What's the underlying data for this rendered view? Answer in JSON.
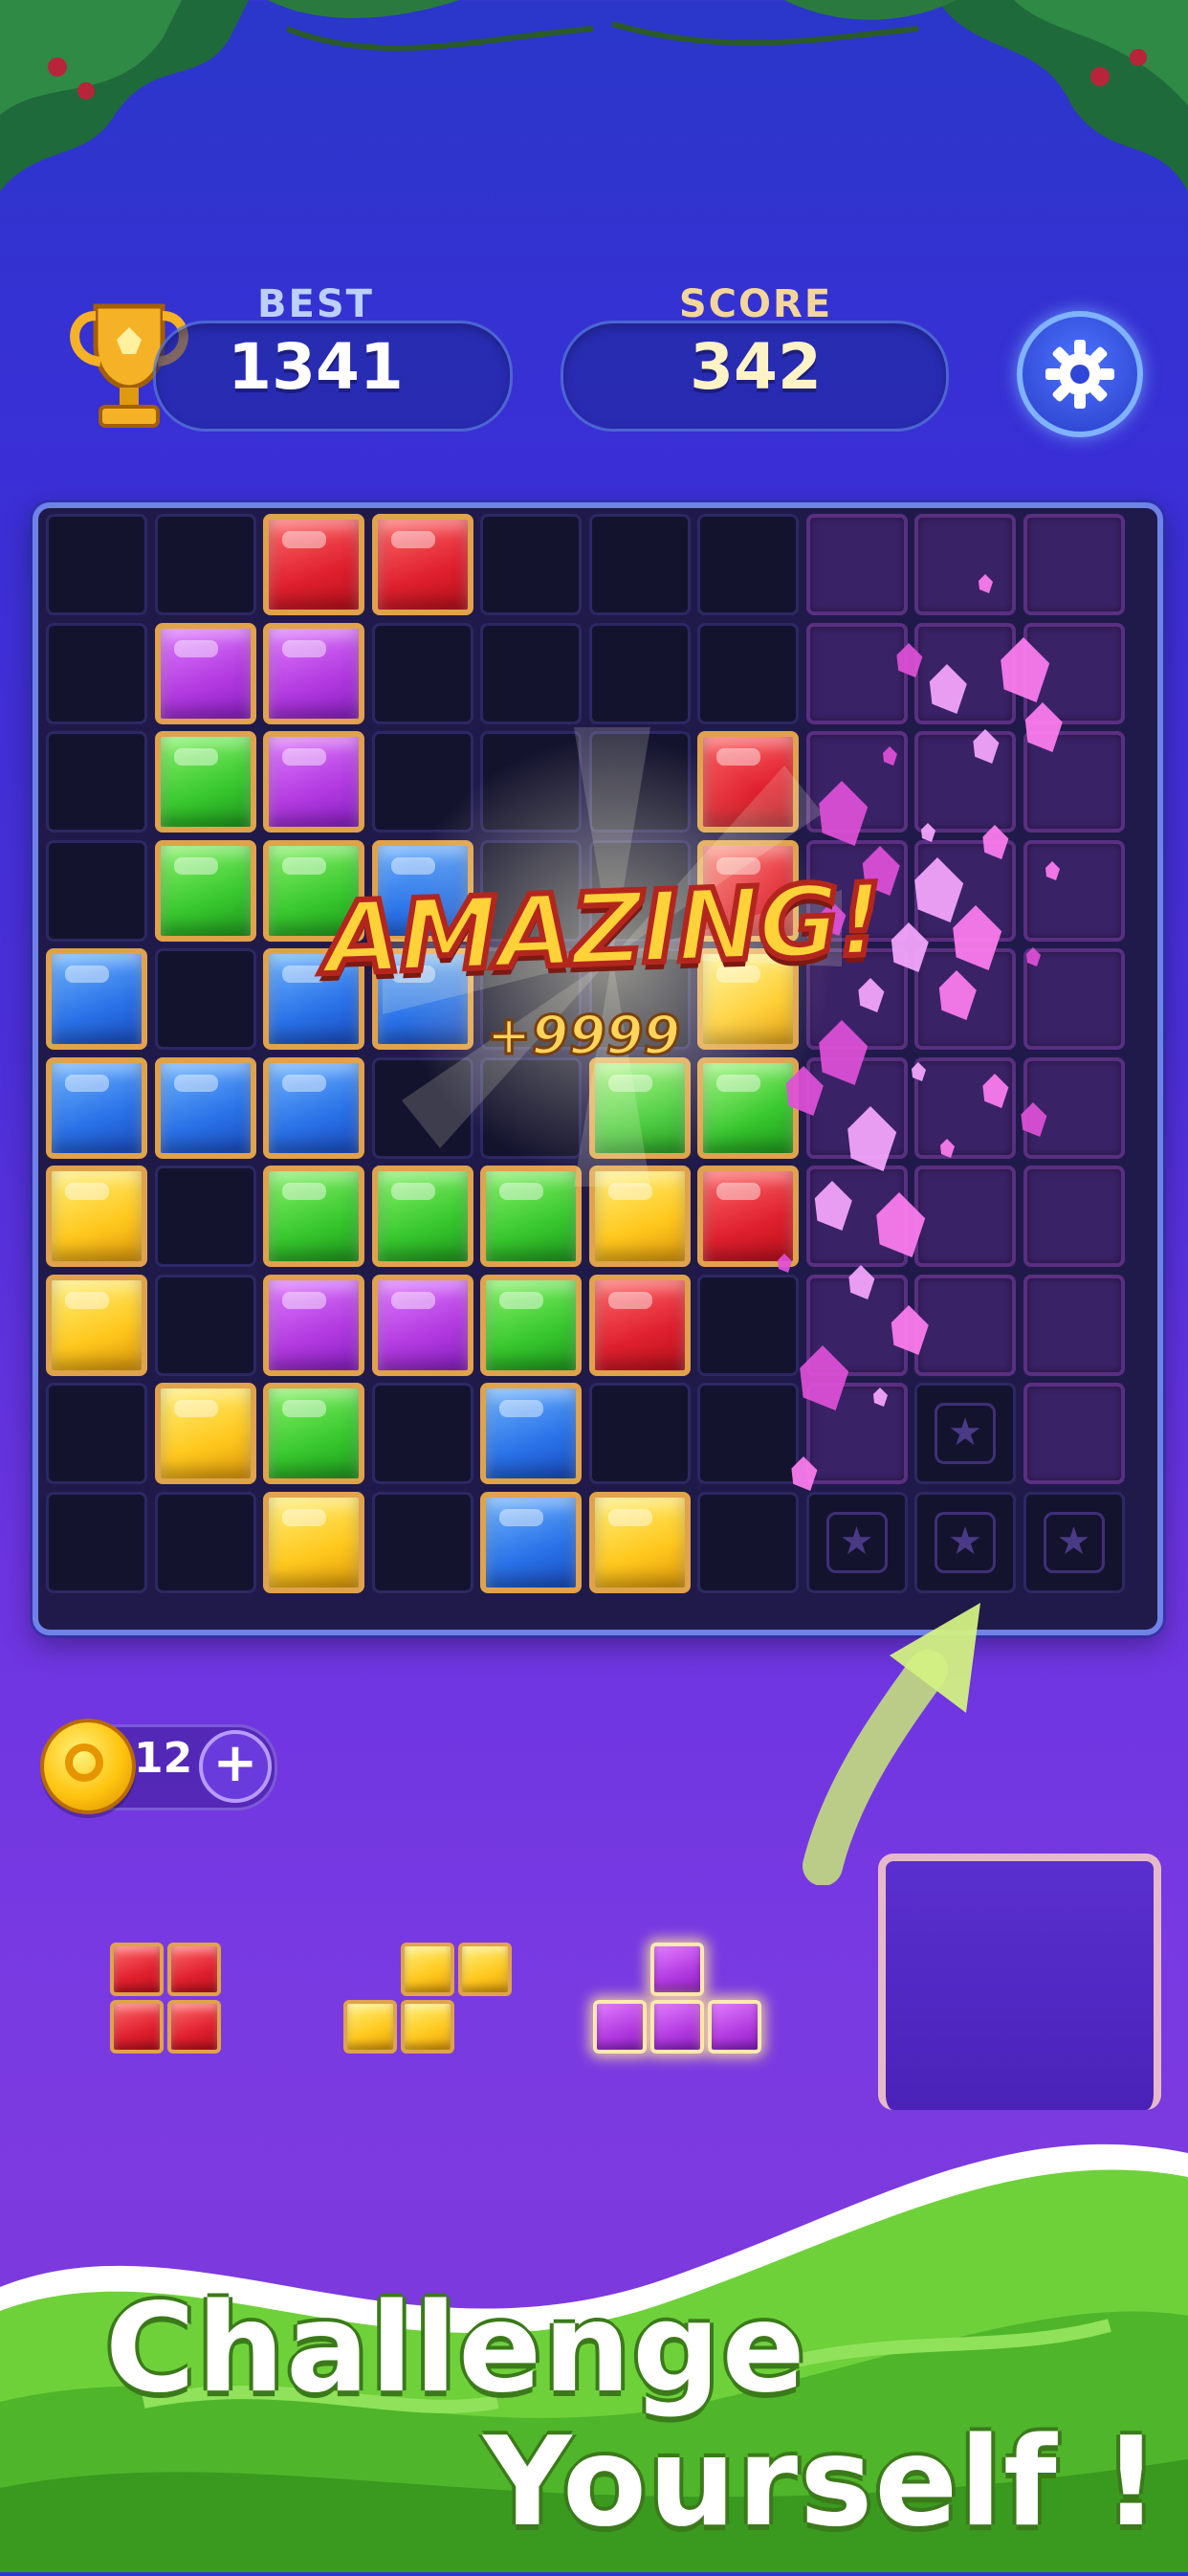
{
  "header": {
    "best_label": "BEST",
    "best_value": "1341",
    "score_label": "SCORE",
    "score_value": "342",
    "settings_icon": "gear-icon",
    "trophy_icon": "trophy-icon"
  },
  "board": {
    "columns": 10,
    "rows": 10,
    "cells": [
      [
        "empty",
        "empty",
        "red",
        "red",
        "empty",
        "empty",
        "empty",
        "dark",
        "dark",
        "dark"
      ],
      [
        "empty",
        "purple",
        "purple",
        "empty",
        "empty",
        "empty",
        "empty",
        "dark",
        "dark",
        "dark"
      ],
      [
        "empty",
        "green",
        "purple",
        "empty",
        "empty",
        "empty",
        "red",
        "dark",
        "dark",
        "dark"
      ],
      [
        "empty",
        "green",
        "green",
        "blue",
        "empty",
        "empty",
        "red",
        "dark",
        "dark",
        "dark"
      ],
      [
        "blue",
        "empty",
        "blue",
        "blue",
        "empty",
        "empty",
        "yellow",
        "dark",
        "dark",
        "dark"
      ],
      [
        "blue",
        "blue",
        "blue",
        "empty",
        "empty",
        "green",
        "green",
        "dark",
        "dark",
        "dark"
      ],
      [
        "yellow",
        "empty",
        "green",
        "green",
        "green",
        "yellow",
        "red",
        "dark",
        "dark",
        "dark"
      ],
      [
        "yellow",
        "empty",
        "purple",
        "purple",
        "green",
        "red",
        "empty",
        "dark",
        "dark",
        "dark"
      ],
      [
        "empty",
        "yellow",
        "green",
        "empty",
        "blue",
        "empty",
        "empty",
        "dark",
        "star",
        "dark"
      ],
      [
        "empty",
        "empty",
        "yellow",
        "empty",
        "blue",
        "yellow",
        "empty",
        "star",
        "star",
        "star"
      ]
    ]
  },
  "effect": {
    "message": "AMAZING!",
    "bonus": "+9999"
  },
  "coins": {
    "count": "12",
    "coin_icon": "coin-icon",
    "add_icon": "plus-icon"
  },
  "pieces": [
    {
      "color": "red",
      "cells": [
        [
          0,
          0
        ],
        [
          1,
          0
        ],
        [
          0,
          1
        ],
        [
          1,
          1
        ]
      ]
    },
    {
      "color": "yellow",
      "cells": [
        [
          1,
          0
        ],
        [
          2,
          0
        ],
        [
          0,
          1
        ],
        [
          1,
          1
        ]
      ]
    },
    {
      "color": "purple",
      "cells": [
        [
          1,
          0
        ],
        [
          0,
          1
        ],
        [
          1,
          1
        ],
        [
          2,
          1
        ]
      ]
    }
  ],
  "banner": {
    "line1": "Challenge",
    "line2": "Yourself !"
  },
  "colors": {
    "red": "#e0202e",
    "purple": "#b23ae0",
    "green": "#38c82e",
    "blue": "#2a72e8",
    "yellow": "#ffc81e",
    "gem_border": "#e0a24b",
    "board_bg": "#201a4a"
  }
}
